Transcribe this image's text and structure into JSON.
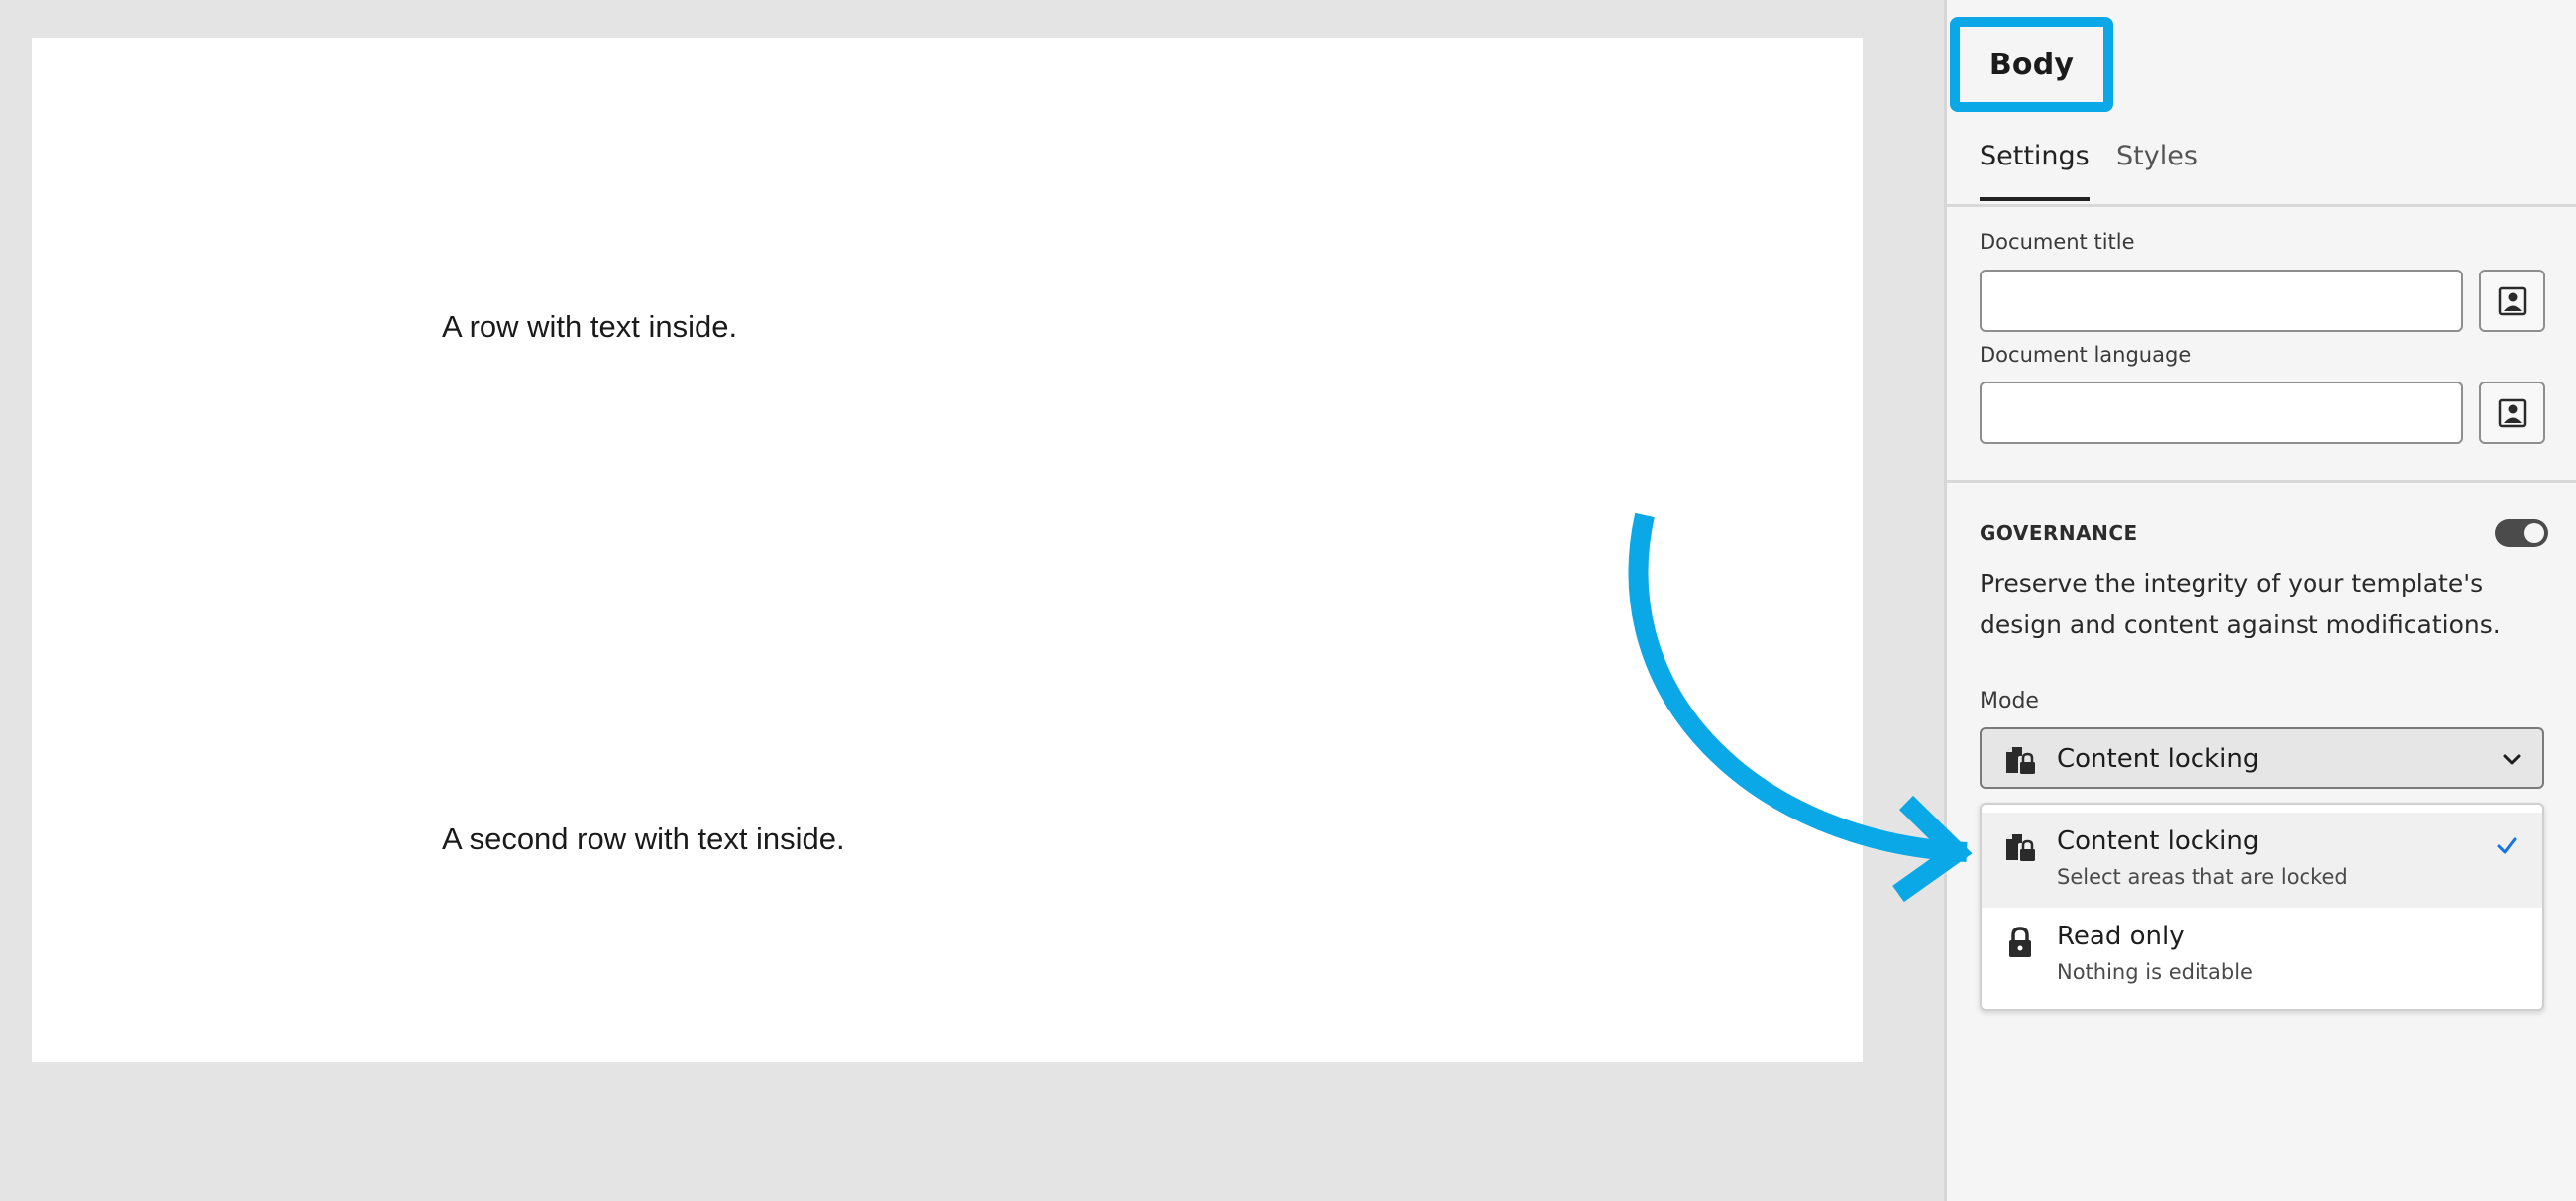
{
  "canvas": {
    "rows": [
      {
        "text": "A row with text inside."
      },
      {
        "text": "A second row with text inside."
      }
    ]
  },
  "panel": {
    "title": "Body",
    "tabs": [
      {
        "label": "Settings",
        "active": true
      },
      {
        "label": "Styles",
        "active": false
      }
    ],
    "fields": {
      "document_title": {
        "label": "Document title",
        "value": "",
        "placeholder": ""
      },
      "document_language": {
        "label": "Document language",
        "value": "",
        "placeholder": ""
      }
    },
    "governance": {
      "heading": "GOVERNANCE",
      "toggle_on": true,
      "description": "Preserve the integrity of your template's design and content against modifications.",
      "mode_label": "Mode",
      "mode_selected": "Content locking",
      "options": [
        {
          "label": "Content locking",
          "description": "Select areas that are locked",
          "icon": "content-lock-icon",
          "selected": true
        },
        {
          "label": "Read only",
          "description": "Nothing is editable",
          "icon": "lock-icon",
          "selected": false
        }
      ]
    }
  },
  "colors": {
    "highlight": "#0aa8e6",
    "check": "#1473e6",
    "toggle": "#4b4b4b"
  }
}
